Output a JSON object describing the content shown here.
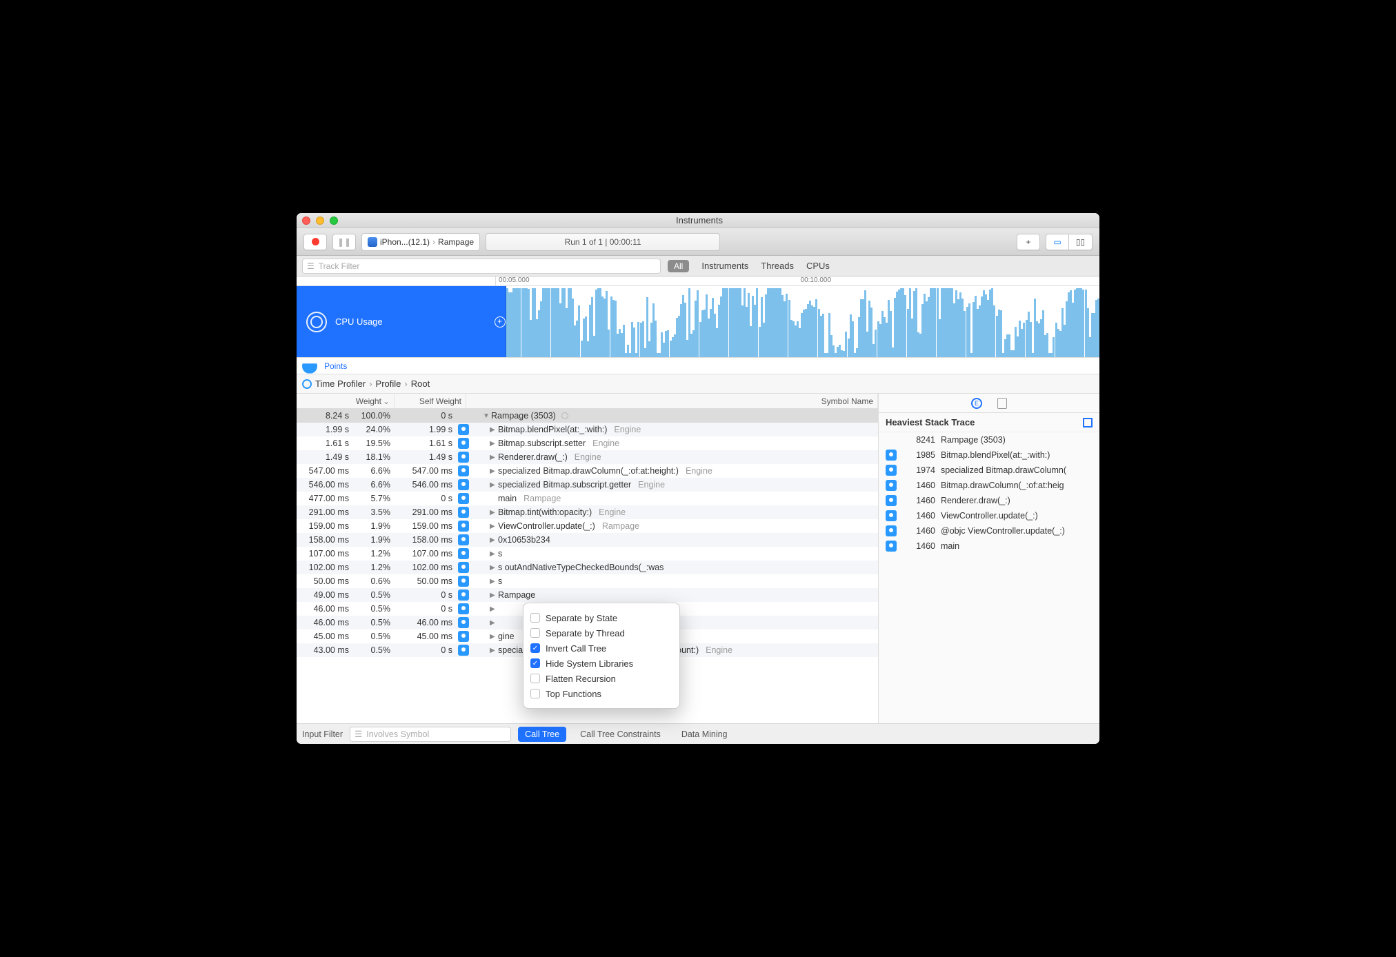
{
  "title": "Instruments",
  "toolbar": {
    "device": "iPhon...(12.1)",
    "target": "Rampage",
    "run_status": "Run 1 of 1  |  00:00:11",
    "plus": "+"
  },
  "filterbar": {
    "placeholder": "Track Filter",
    "all": "All",
    "tabs": [
      "Instruments",
      "Threads",
      "CPUs"
    ]
  },
  "timeline": {
    "ticks": [
      "00:05.000",
      "00:10.000"
    ]
  },
  "track": {
    "label": "CPU Usage"
  },
  "points_label": "Points",
  "breadcrumb": [
    "Time Profiler",
    "Profile",
    "Root"
  ],
  "columns": {
    "weight": "Weight",
    "self": "Self Weight",
    "symbol": "Symbol Name"
  },
  "rows": [
    {
      "w": "8.24 s",
      "p": "100.0%",
      "sw": "0 s",
      "icon": false,
      "sel": true,
      "d": "down",
      "ind": 1,
      "sym": "Rampage (3503)",
      "lib": "",
      "dim": true
    },
    {
      "w": "1.99 s",
      "p": "24.0%",
      "sw": "1.99 s",
      "icon": true,
      "d": "right",
      "ind": 2,
      "sym": "Bitmap.blendPixel(at:_:with:)",
      "lib": "Engine"
    },
    {
      "w": "1.61 s",
      "p": "19.5%",
      "sw": "1.61 s",
      "icon": true,
      "d": "right",
      "ind": 2,
      "sym": "Bitmap.subscript.setter",
      "lib": "Engine"
    },
    {
      "w": "1.49 s",
      "p": "18.1%",
      "sw": "1.49 s",
      "icon": true,
      "d": "right",
      "ind": 2,
      "sym": "Renderer.draw(_:)",
      "lib": "Engine"
    },
    {
      "w": "547.00 ms",
      "p": "6.6%",
      "sw": "547.00 ms",
      "icon": true,
      "d": "right",
      "ind": 2,
      "sym": "specialized Bitmap.drawColumn(_:of:at:height:)",
      "lib": "Engine"
    },
    {
      "w": "546.00 ms",
      "p": "6.6%",
      "sw": "546.00 ms",
      "icon": true,
      "d": "right",
      "ind": 2,
      "sym": "specialized Bitmap.subscript.getter",
      "lib": "Engine"
    },
    {
      "w": "477.00 ms",
      "p": "5.7%",
      "sw": "0 s",
      "icon": true,
      "d": "",
      "ind": 2,
      "sym": "  main",
      "lib": "Rampage"
    },
    {
      "w": "291.00 ms",
      "p": "3.5%",
      "sw": "291.00 ms",
      "icon": true,
      "d": "right",
      "ind": 2,
      "sym": "Bitmap.tint(with:opacity:)",
      "lib": "Engine"
    },
    {
      "w": "159.00 ms",
      "p": "1.9%",
      "sw": "159.00 ms",
      "icon": true,
      "d": "right",
      "ind": 2,
      "sym": "ViewController.update(_:)",
      "lib": "Rampage"
    },
    {
      "w": "158.00 ms",
      "p": "1.9%",
      "sw": "158.00 ms",
      "icon": true,
      "d": "right",
      "ind": 2,
      "sym": "0x10653b234",
      "lib": ""
    },
    {
      "w": "107.00 ms",
      "p": "1.2%",
      "sw": "107.00 ms",
      "icon": true,
      "d": "right",
      "ind": 2,
      "sym": "s",
      "lib": ""
    },
    {
      "w": "102.00 ms",
      "p": "1.2%",
      "sw": "102.00 ms",
      "icon": true,
      "d": "right",
      "ind": 2,
      "sym": "s                                                   outAndNativeTypeCheckedBounds(_:was",
      "lib": ""
    },
    {
      "w": "50.00 ms",
      "p": "0.6%",
      "sw": "50.00 ms",
      "icon": true,
      "d": "right",
      "ind": 2,
      "sym": "s",
      "lib": ""
    },
    {
      "w": "49.00 ms",
      "p": "0.5%",
      "sw": "0 s",
      "icon": true,
      "d": "right",
      "ind": 2,
      "sym": "                                                           Rampage",
      "lib": ""
    },
    {
      "w": "46.00 ms",
      "p": "0.5%",
      "sw": "0 s",
      "icon": true,
      "d": "right",
      "ind": 2,
      "sym": "",
      "lib": ""
    },
    {
      "w": "46.00 ms",
      "p": "0.5%",
      "sw": "46.00 ms",
      "icon": true,
      "d": "right",
      "ind": 2,
      "sym": "",
      "lib": ""
    },
    {
      "w": "45.00 ms",
      "p": "0.5%",
      "sw": "45.00 ms",
      "icon": true,
      "d": "right",
      "ind": 2,
      "sym": "                                                         gine",
      "lib": ""
    },
    {
      "w": "43.00 ms",
      "p": "0.5%",
      "sw": "0 s",
      "icon": true,
      "d": "right",
      "ind": 2,
      "sym": "specialized         safeMutablePointer.initialize(from:count:)",
      "lib": "Engine"
    }
  ],
  "popover": {
    "items": [
      {
        "label": "Separate by State",
        "on": false
      },
      {
        "label": "Separate by Thread",
        "on": false
      },
      {
        "label": "Invert Call Tree",
        "on": true
      },
      {
        "label": "Hide System Libraries",
        "on": true
      },
      {
        "label": "Flatten Recursion",
        "on": false
      },
      {
        "label": "Top Functions",
        "on": false
      }
    ]
  },
  "rightpanel": {
    "title": "Heaviest Stack Trace",
    "rows": [
      {
        "icon": false,
        "n": "8241",
        "s": "Rampage (3503)"
      },
      {
        "icon": true,
        "n": "1985",
        "s": "Bitmap.blendPixel(at:_:with:)"
      },
      {
        "icon": true,
        "n": "1974",
        "s": "specialized Bitmap.drawColumn("
      },
      {
        "icon": true,
        "n": "1460",
        "s": "Bitmap.drawColumn(_:of:at:heig"
      },
      {
        "icon": true,
        "n": "1460",
        "s": "Renderer.draw(_:)"
      },
      {
        "icon": true,
        "n": "1460",
        "s": "ViewController.update(_:)"
      },
      {
        "icon": true,
        "n": "1460",
        "s": "@objc ViewController.update(_:)"
      },
      {
        "icon": true,
        "n": "1460",
        "s": "main"
      }
    ]
  },
  "bottombar": {
    "input": "Input Filter",
    "symbol_ph": "Involves Symbol",
    "b1": "Call Tree",
    "b2": "Call Tree Constraints",
    "b3": "Data Mining"
  }
}
